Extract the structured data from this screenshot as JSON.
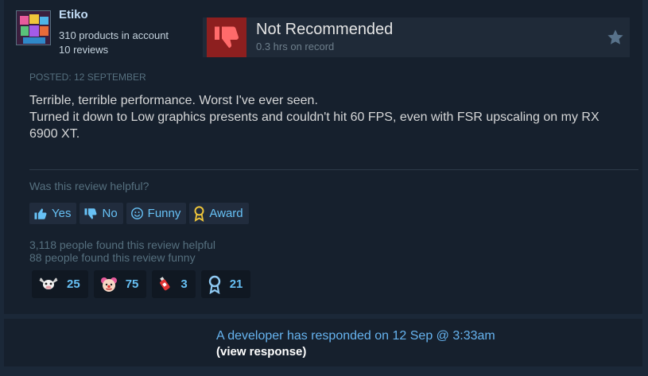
{
  "author": {
    "name": "Etiko",
    "products": "310 products in account",
    "reviews": "10 reviews"
  },
  "verdict": {
    "title": "Not Recommended",
    "hours": "0.3 hrs on record",
    "icon": "thumbs-down-icon",
    "color": "#8d1f1f"
  },
  "review": {
    "posted": "POSTED: 12 SEPTEMBER",
    "line1": "Terrible, terrible performance. Worst I've ever seen.",
    "line2": "Turned it down to Low graphics presents and couldn't hit 60 FPS, even with FSR upscaling on my RX 6900 XT."
  },
  "helpful": {
    "question": "Was this review helpful?",
    "buttons": {
      "yes": "Yes",
      "no": "No",
      "funny": "Funny",
      "award": "Award"
    },
    "found_helpful": "3,118 people found this review helpful",
    "found_funny": "88 people found this review funny"
  },
  "awards": [
    {
      "icon": "cow-icon",
      "count": "25"
    },
    {
      "icon": "clown-face-icon",
      "count": "75"
    },
    {
      "icon": "hot-sauce-icon",
      "count": "3"
    },
    {
      "icon": "ribbon-icon",
      "count": "21"
    }
  ],
  "developer_response": {
    "text": "A developer has responded on 12 Sep @ 3:33am",
    "link": "(view response)"
  },
  "colors": {
    "accent": "#67c1f5",
    "muted": "#56707f",
    "card": "#16202d",
    "page": "#1b2838"
  }
}
